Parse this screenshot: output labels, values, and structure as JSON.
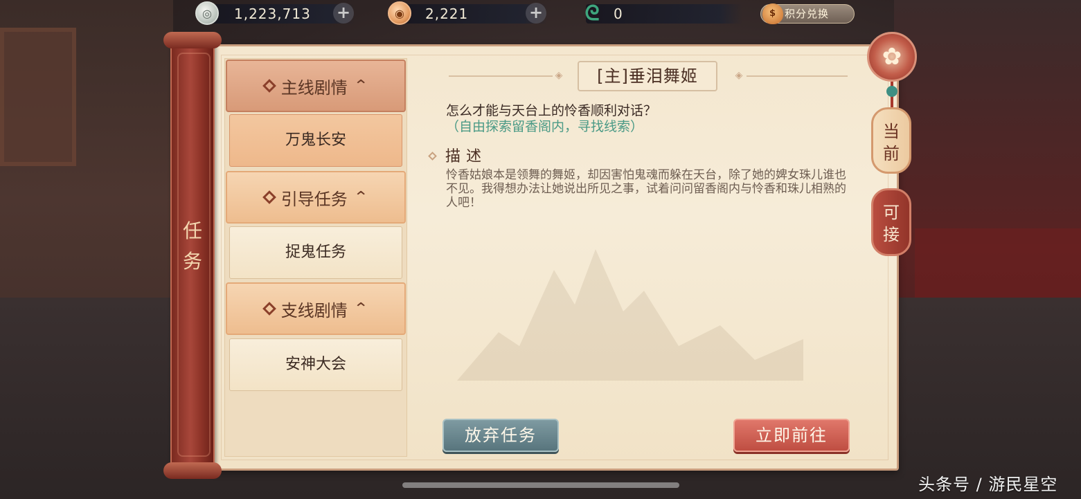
{
  "currency": {
    "silver": {
      "icon": "silver-coin-icon",
      "value": "1,223,713"
    },
    "copper": {
      "icon": "copper-coin-icon",
      "value": "2,221"
    },
    "jade": {
      "icon": "jade-token-icon",
      "value": "0"
    },
    "exchange_label": "积分兑换"
  },
  "panel": {
    "vertical_title": "任务",
    "categories": [
      {
        "label": "主线剧情",
        "items": [
          "万鬼长安"
        ]
      },
      {
        "label": "引导任务",
        "items": [
          "捉鬼任务"
        ]
      },
      {
        "label": "支线剧情",
        "items": [
          "安神大会"
        ]
      }
    ]
  },
  "quest": {
    "title": "[主]垂泪舞姬",
    "question": "怎么才能与天台上的怜香顺利对话？",
    "hint": "（自由探索留香阁内，寻找线索）",
    "desc_label": "描述",
    "desc_text": "怜香姑娘本是领舞的舞姬，却因害怕鬼魂而躲在天台，除了她的婢女珠儿谁也不见。我得想办法让她说出所见之事，试着问问留香阁内与怜香和珠儿相熟的人吧！"
  },
  "buttons": {
    "abandon": "放弃任务",
    "go": "立即前往"
  },
  "tabs": {
    "current": "当前",
    "accept": "可接"
  },
  "watermark": "头条号 / 游民星空",
  "colors": {
    "accent_red": "#bf4e42",
    "hint_teal": "#4a9a86",
    "paper": "#f4e7cf"
  }
}
